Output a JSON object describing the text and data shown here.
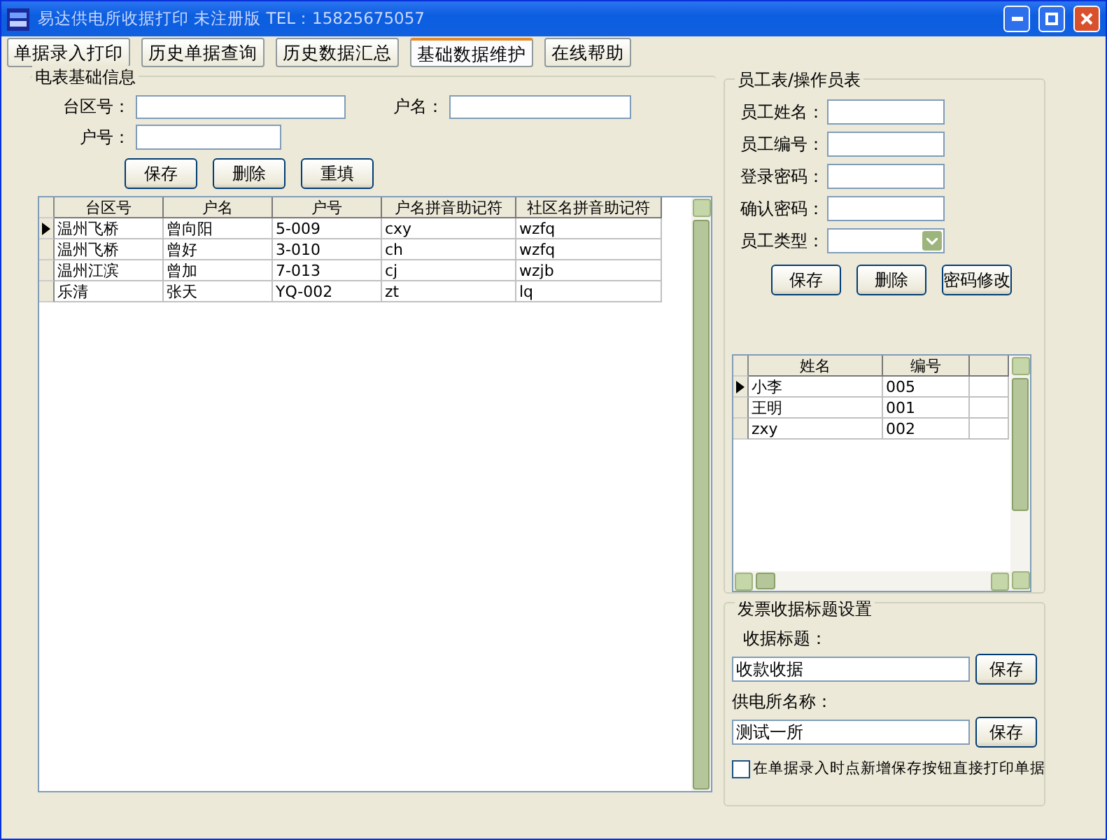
{
  "window": {
    "title": "易达供电所收据打印 未注册版  TEL：15825675057"
  },
  "tabs": [
    {
      "label": "单据录入打印",
      "selected": false
    },
    {
      "label": "历史单据查询",
      "selected": false
    },
    {
      "label": "历史数据汇总",
      "selected": false
    },
    {
      "label": "基础数据维护",
      "selected": true
    },
    {
      "label": "在线帮助",
      "selected": false
    }
  ],
  "meter_info": {
    "title": "电表基础信息",
    "fields": [
      {
        "label": "台区号："
      },
      {
        "label": "户名："
      },
      {
        "label": "户号："
      }
    ],
    "buttons": [
      "保存",
      "删除",
      "重填"
    ],
    "table": {
      "columns": [
        "台区号",
        "户名",
        "户号",
        "户名拼音助记符",
        "社区名拼音助记符"
      ],
      "rows": [
        {
          "selected": true,
          "cells": [
            "温州飞桥",
            "曾向阳",
            "5-009",
            "cxy",
            "wzfq"
          ]
        },
        {
          "selected": false,
          "cells": [
            "温州飞桥",
            "曾好",
            "3-010",
            "ch",
            "wzfq"
          ]
        },
        {
          "selected": false,
          "cells": [
            "温州江滨",
            "曾加",
            "7-013",
            "cj",
            "wzjb"
          ]
        },
        {
          "selected": false,
          "cells": [
            "乐清",
            "张天",
            "YQ-002",
            "zt",
            "lq"
          ]
        }
      ]
    }
  },
  "staff": {
    "title": "员工表/操作员表",
    "fields": [
      {
        "label": "员工姓名：",
        "kind": "text"
      },
      {
        "label": "员工编号：",
        "kind": "text"
      },
      {
        "label": "登录密码：",
        "kind": "text"
      },
      {
        "label": "确认密码：",
        "kind": "text"
      },
      {
        "label": "员工类型：",
        "kind": "select"
      }
    ],
    "buttons": [
      "保存",
      "删除",
      "密码修改"
    ],
    "table": {
      "columns": [
        "姓名",
        "编号"
      ],
      "rows": [
        {
          "selected": true,
          "cells": [
            "小李",
            "005"
          ]
        },
        {
          "selected": false,
          "cells": [
            "王明",
            "001"
          ]
        },
        {
          "selected": false,
          "cells": [
            "zxy",
            "002"
          ]
        }
      ]
    }
  },
  "receipt": {
    "title": "发票收据标题设置",
    "fields": [
      {
        "label": "收据标题：",
        "value": "收款收据",
        "button": "保存"
      },
      {
        "label": "供电所名称：",
        "value": "测试一所",
        "button": "保存"
      }
    ],
    "auto_print": {
      "label": "在单据录入时点新增保存按钮直接打印单据",
      "checked": false
    }
  }
}
